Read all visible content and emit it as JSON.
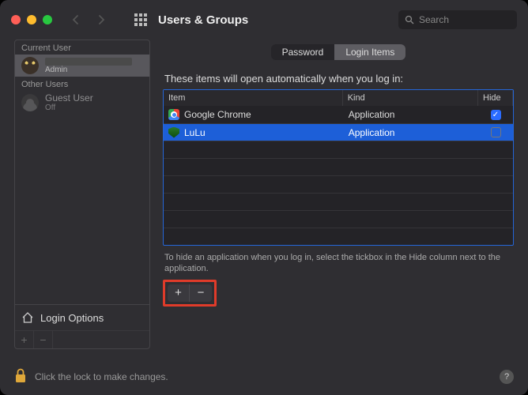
{
  "colors": {
    "traffic_close": "#ff5f57",
    "traffic_min": "#febc2e",
    "traffic_max": "#28c840",
    "table_border": "#2566d8",
    "highlight": "#e03b2a"
  },
  "titlebar": {
    "title": "Users & Groups",
    "search_placeholder": "Search"
  },
  "sidebar": {
    "section_current": "Current User",
    "section_other": "Other Users",
    "current_user": {
      "name_redacted": true,
      "role": "Admin"
    },
    "guest_user": {
      "name": "Guest User",
      "status": "Off"
    },
    "login_options_label": "Login Options"
  },
  "main": {
    "tabs": {
      "password": "Password",
      "login_items": "Login Items",
      "active": "login_items"
    },
    "intro": "These items will open automatically when you log in:",
    "columns": {
      "item": "Item",
      "kind": "Kind",
      "hide": "Hide"
    },
    "rows": [
      {
        "icon": "chrome",
        "name": "Google Chrome",
        "kind": "Application",
        "hide": true,
        "selected": false
      },
      {
        "icon": "lulu",
        "name": "LuLu",
        "kind": "Application",
        "hide": false,
        "selected": true
      }
    ],
    "hint": "To hide an application when you log in, select the tickbox in the Hide column next to the application.",
    "empty_row_count": 6
  },
  "footer": {
    "lock_text": "Click the lock to make changes.",
    "help_glyph": "?"
  }
}
